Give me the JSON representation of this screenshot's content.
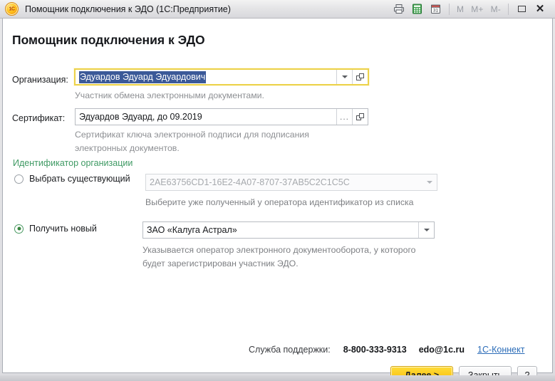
{
  "titlebar": {
    "app_icon": "1c-logo-icon",
    "title": "Помощник подключения к ЭДО  (1С:Предприятие)",
    "tools": [
      {
        "name": "print-icon",
        "label": "printer-icon"
      },
      {
        "name": "calculator-icon",
        "label": "calculator-icon"
      },
      {
        "name": "calendar-icon",
        "label": "calendar-icon"
      }
    ],
    "memory": [
      {
        "name": "memory-recall-button",
        "label": "M"
      },
      {
        "name": "memory-add-button",
        "label": "M+"
      },
      {
        "name": "memory-subtract-button",
        "label": "M-"
      }
    ],
    "window_controls": [
      {
        "name": "maximize-button",
        "label": "maximize-icon"
      },
      {
        "name": "close-button",
        "label": "✕"
      }
    ]
  },
  "page": {
    "title": "Помощник подключения к ЭДО"
  },
  "organization": {
    "label": "Организация:",
    "value": "Эдуардов Эдуард Эдуардович",
    "selected": true,
    "hint": "Участник обмена электронными документами.",
    "dropdown_icon": "chevron-down-icon",
    "open_icon": "open-window-icon"
  },
  "certificate": {
    "label": "Сертификат:",
    "value": "Эдуардов Эдуард, до 09.2019",
    "hint_line1": "Сертификат ключа электронной подписи для подписания",
    "hint_line2": "электронных документов.",
    "select_icon": "ellipsis-icon",
    "open_icon": "open-window-icon"
  },
  "identifier": {
    "section_title": "Идентификатор организации",
    "section_color": "#3f9a64",
    "existing": {
      "radio_label": "Выбрать существующий",
      "selected": false,
      "value": "2AE63756CD1-16E2-4A07-8707-37AB5C2C1C5C",
      "enabled": false,
      "hint": "Выберите уже полученный у оператора идентификатор из списка",
      "dropdown_icon": "chevron-down-icon"
    },
    "new": {
      "radio_label": "Получить новый",
      "selected": true,
      "value": "ЗАО «Калуга Астрал»",
      "enabled": true,
      "hint_line1": "Указывается оператор электронного документооборота, у которого",
      "hint_line2": "будет зарегистрирован участник ЭДО.",
      "dropdown_icon": "chevron-down-icon"
    }
  },
  "footer": {
    "support_label": "Служба поддержки:",
    "phone": "8-800-333-9313",
    "email": "edo@1c.ru",
    "link": "1С-Коннект",
    "link_color": "#2b6cb8",
    "buttons": {
      "next": "Далее >",
      "close": "Закрыть",
      "help": "?"
    }
  }
}
